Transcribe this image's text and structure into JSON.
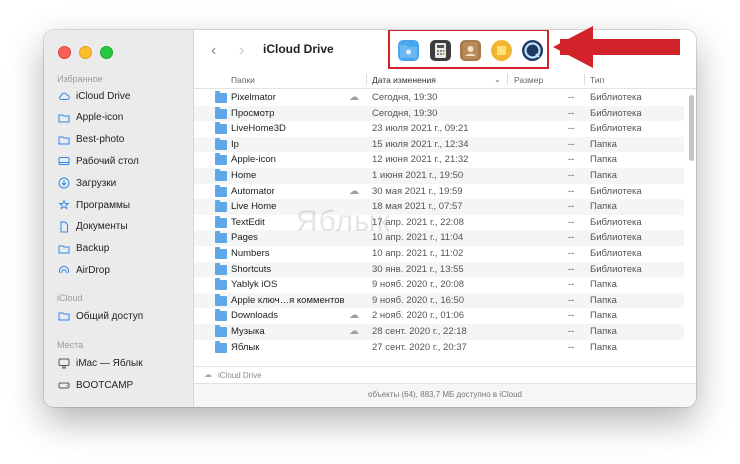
{
  "window": {
    "title": "iCloud Drive"
  },
  "sidebar": {
    "favorites_header": "Избранное",
    "favorites": [
      {
        "label": "iCloud Drive",
        "icon": "cloud-icon"
      },
      {
        "label": "Apple-icon",
        "icon": "folder-icon"
      },
      {
        "label": "Best-photo",
        "icon": "folder-icon"
      },
      {
        "label": "Рабочий стол",
        "icon": "desktop-icon"
      },
      {
        "label": "Загрузки",
        "icon": "download-icon"
      },
      {
        "label": "Программы",
        "icon": "apps-icon"
      },
      {
        "label": "Документы",
        "icon": "document-icon"
      },
      {
        "label": "Backup",
        "icon": "folder-icon"
      },
      {
        "label": "AirDrop",
        "icon": "airdrop-icon"
      }
    ],
    "icloud_header": "iCloud",
    "icloud": [
      {
        "label": "Общий доступ",
        "icon": "shared-folder-icon"
      }
    ],
    "locations_header": "Места",
    "locations": [
      {
        "label": "iMac — Яблык",
        "icon": "imac-icon"
      },
      {
        "label": "BOOTCAMP",
        "icon": "drive-icon"
      }
    ]
  },
  "toolbar": {
    "back_glyph": "‹",
    "forward_glyph": "›",
    "apps": [
      "app-folder-icon",
      "calculator-icon",
      "contacts-icon",
      "stickies-icon",
      "quicktime-icon"
    ],
    "highlight_color": "#d2232a"
  },
  "columns": {
    "name": "Папки",
    "date": "Дата изменения",
    "size": "Размер",
    "kind": "Тип"
  },
  "rows": [
    {
      "name": "Pixelmator",
      "date": "Сегодня, 19:30",
      "size": "--",
      "kind": "Библиотека",
      "cloud": true
    },
    {
      "name": "Просмотр",
      "date": "Сегодня, 19:30",
      "size": "--",
      "kind": "Библиотека",
      "cloud": false
    },
    {
      "name": "LiveHome3D",
      "date": "23 июля 2021 г., 09:21",
      "size": "--",
      "kind": "Библиотека",
      "cloud": false
    },
    {
      "name": "Ip",
      "date": "15 июля 2021 г., 12:34",
      "size": "--",
      "kind": "Папка",
      "cloud": false
    },
    {
      "name": "Apple-icon",
      "date": "12 июня 2021 г., 21:32",
      "size": "--",
      "kind": "Папка",
      "cloud": false
    },
    {
      "name": "Home",
      "date": "1 июня 2021 г., 19:50",
      "size": "--",
      "kind": "Папка",
      "cloud": false
    },
    {
      "name": "Automator",
      "date": "30 мая 2021 г., 19:59",
      "size": "--",
      "kind": "Библиотека",
      "cloud": true
    },
    {
      "name": "Live Home",
      "date": "18 мая 2021 г., 07:57",
      "size": "--",
      "kind": "Папка",
      "cloud": false
    },
    {
      "name": "TextEdit",
      "date": "17 апр. 2021 г., 22:08",
      "size": "--",
      "kind": "Библиотека",
      "cloud": false
    },
    {
      "name": "Pages",
      "date": "10 апр. 2021 г., 11:04",
      "size": "--",
      "kind": "Библиотека",
      "cloud": false
    },
    {
      "name": "Numbers",
      "date": "10 апр. 2021 г., 11:02",
      "size": "--",
      "kind": "Библиотека",
      "cloud": false
    },
    {
      "name": "Shortcuts",
      "date": "30 янв. 2021 г., 13:55",
      "size": "--",
      "kind": "Библиотека",
      "cloud": false
    },
    {
      "name": "Yablyk iOS",
      "date": "9 нояб. 2020 г., 20:08",
      "size": "--",
      "kind": "Папка",
      "cloud": false
    },
    {
      "name": "Apple ключ…я комментов",
      "date": "9 нояб. 2020 г., 16:50",
      "size": "--",
      "kind": "Папка",
      "cloud": false
    },
    {
      "name": "Downloads",
      "date": "2 нояб. 2020 г., 01:06",
      "size": "--",
      "kind": "Папка",
      "cloud": true
    },
    {
      "name": "Музыка",
      "date": "28 сент. 2020 г., 22:18",
      "size": "--",
      "kind": "Папка",
      "cloud": true
    },
    {
      "name": "Яблык",
      "date": "27 сент. 2020 г., 20:37",
      "size": "--",
      "kind": "Папка",
      "cloud": false
    }
  ],
  "pathbar": {
    "label": "iCloud Drive"
  },
  "status": {
    "text": "объекты (64), 883,7 МБ доступно в iCloud"
  },
  "watermark": "Яблык"
}
